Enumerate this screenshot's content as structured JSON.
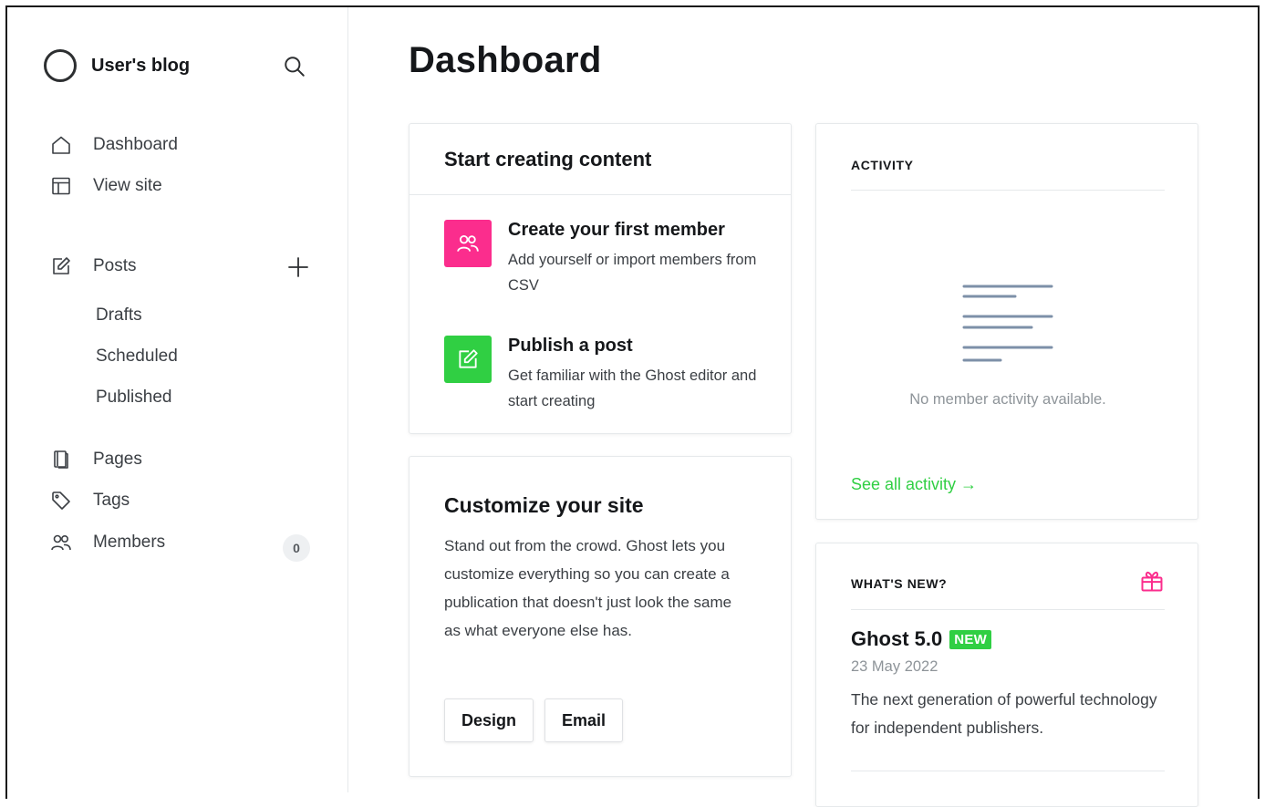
{
  "sidebar": {
    "brand_title": "User's blog",
    "top_nav": [
      {
        "label": "Dashboard",
        "icon": "home-icon"
      },
      {
        "label": "View site",
        "icon": "layout-icon"
      }
    ],
    "posts": {
      "label": "Posts",
      "icon": "edit-icon"
    },
    "post_sub": [
      "Drafts",
      "Scheduled",
      "Published"
    ],
    "bottom_nav": [
      {
        "label": "Pages",
        "icon": "page-icon"
      },
      {
        "label": "Tags",
        "icon": "tag-icon"
      },
      {
        "label": "Members",
        "icon": "members-icon",
        "count": "0"
      }
    ]
  },
  "main": {
    "page_title": "Dashboard",
    "start_card": {
      "title": "Start creating content",
      "tasks": [
        {
          "title": "Create your first member",
          "desc": "Add yourself or import members from CSV",
          "color": "#fb2d8d",
          "icon": "members-icon"
        },
        {
          "title": "Publish a post",
          "desc": "Get familiar with the Ghost editor and start creating",
          "color": "#30cf43",
          "icon": "edit-icon"
        }
      ]
    },
    "customize_card": {
      "title": "Customize your site",
      "desc": "Stand out from the crowd. Ghost lets you customize everything so you can create a publication that doesn't just look the same as what everyone else has.",
      "buttons": [
        "Design",
        "Email"
      ]
    },
    "activity_card": {
      "label": "ACTIVITY",
      "empty_text": "No member activity available.",
      "link": "See all activity →",
      "link_color": "#30cf43"
    },
    "news_card": {
      "label": "WHAT'S NEW?",
      "post_title": "Ghost 5.0",
      "badge": "NEW",
      "date": "23 May 2022",
      "desc": "The next generation of powerful technology for independent publishers."
    }
  }
}
